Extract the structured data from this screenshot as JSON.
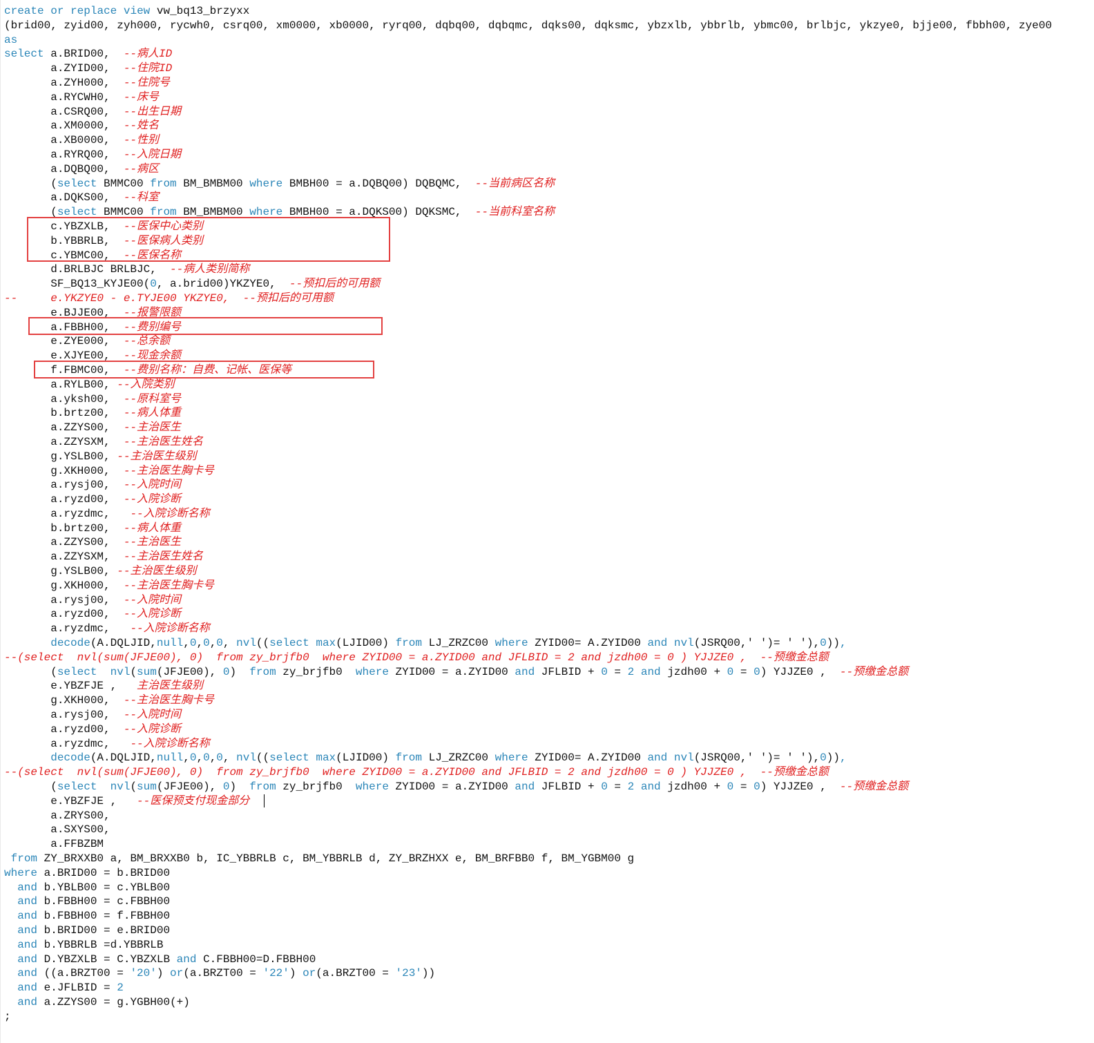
{
  "editor": {
    "colors": {
      "background": "#ffffff",
      "text": "#111111",
      "keyword": "#2b86b8",
      "comment": "#e02020",
      "highlight_box": "#e34040"
    },
    "lines": [
      [
        [
          "k",
          "create"
        ],
        [
          "t",
          " "
        ],
        [
          "k",
          "or"
        ],
        [
          "t",
          " "
        ],
        [
          "k",
          "replace"
        ],
        [
          "t",
          " "
        ],
        [
          "k",
          "view"
        ],
        [
          "t",
          " vw_bq13_brzyxx"
        ]
      ],
      [
        [
          "t",
          "(brid00, zyid00, zyh000, rycwh0, csrq00, xm0000, xb0000, ryrq00, dqbq00, dqbqmc, dqks00, dqksmc, ybzxlb, ybbrlb, ybmc00, brlbjc, ykzye0, bjje00, fbbh00, zye00"
        ]
      ],
      [
        [
          "k",
          "as"
        ]
      ],
      [
        [
          "k",
          "select"
        ],
        [
          "t",
          " a.BRID00,  "
        ],
        [
          "c",
          "--病人ID"
        ]
      ],
      [
        [
          "t",
          "       a.ZYID00,  "
        ],
        [
          "c",
          "--住院ID"
        ]
      ],
      [
        [
          "t",
          "       a.ZYH000,  "
        ],
        [
          "c",
          "--住院号"
        ]
      ],
      [
        [
          "t",
          "       a.RYCWH0,  "
        ],
        [
          "c",
          "--床号"
        ]
      ],
      [
        [
          "t",
          "       a.CSRQ00,  "
        ],
        [
          "c",
          "--出生日期"
        ]
      ],
      [
        [
          "t",
          "       a.XM0000,  "
        ],
        [
          "c",
          "--姓名"
        ]
      ],
      [
        [
          "t",
          "       a.XB0000,  "
        ],
        [
          "c",
          "--性别"
        ]
      ],
      [
        [
          "t",
          "       a.RYRQ00,  "
        ],
        [
          "c",
          "--入院日期"
        ]
      ],
      [
        [
          "t",
          "       a.DQBQ00,  "
        ],
        [
          "c",
          "--病区"
        ]
      ],
      [
        [
          "t",
          "       ("
        ],
        [
          "k",
          "select"
        ],
        [
          "t",
          " BMMC00 "
        ],
        [
          "k",
          "from"
        ],
        [
          "t",
          " BM_BMBM00 "
        ],
        [
          "k",
          "where"
        ],
        [
          "t",
          " BMBH00 = a.DQBQ00) DQBQMC,  "
        ],
        [
          "c",
          "--当前病区名称"
        ]
      ],
      [
        [
          "t",
          "       a.DQKS00,  "
        ],
        [
          "c",
          "--科室"
        ]
      ],
      [
        [
          "t",
          "       ("
        ],
        [
          "k",
          "select"
        ],
        [
          "t",
          " BMMC00 "
        ],
        [
          "k",
          "from"
        ],
        [
          "t",
          " BM_BMBM00 "
        ],
        [
          "k",
          "where"
        ],
        [
          "t",
          " BMBH00 = a.DQKS00) DQKSMC,  "
        ],
        [
          "c",
          "--当前科室名称"
        ]
      ],
      [
        [
          "t",
          "       c.YBZXLB,  "
        ],
        [
          "c",
          "--医保中心类别"
        ]
      ],
      [
        [
          "t",
          "       b.YBBRLB,  "
        ],
        [
          "c",
          "--医保病人类别"
        ]
      ],
      [
        [
          "t",
          "       c.YBMC00,  "
        ],
        [
          "c",
          "--医保名称"
        ]
      ],
      [
        [
          "t",
          "       d.BRLBJC BRLBJC,  "
        ],
        [
          "c",
          "--病人类别简称"
        ]
      ],
      [
        [
          "t",
          "       SF_BQ13_KYJE00("
        ],
        [
          "n",
          "0"
        ],
        [
          "t",
          ", a.brid00)YKZYE0,  "
        ],
        [
          "c",
          "--预扣后的可用额"
        ]
      ],
      [
        [
          "c",
          "--     e.YKZYE0 - e.TYJE00 YKZYE0,  --预扣后的可用额"
        ]
      ],
      [
        [
          "t",
          "       e.BJJE00,  "
        ],
        [
          "c",
          "--报警限额"
        ]
      ],
      [
        [
          "t",
          "       a.FBBH00,  "
        ],
        [
          "c",
          "--费别编号"
        ]
      ],
      [
        [
          "t",
          "       e.ZYE000,  "
        ],
        [
          "c",
          "--总余额"
        ]
      ],
      [
        [
          "t",
          "       e.XJYE00,  "
        ],
        [
          "c",
          "--现金余额"
        ]
      ],
      [
        [
          "t",
          "       f.FBMC00,  "
        ],
        [
          "c",
          "--费别名称：自费、记帐、医保等"
        ]
      ],
      [
        [
          "t",
          "       a.RYLB00, "
        ],
        [
          "c",
          "--入院类别"
        ]
      ],
      [
        [
          "t",
          "       a.yksh00,  "
        ],
        [
          "c",
          "--原科室号"
        ]
      ],
      [
        [
          "t",
          "       b.brtz00,  "
        ],
        [
          "c",
          "--病人体重"
        ]
      ],
      [
        [
          "t",
          "       a.ZZYS00,  "
        ],
        [
          "c",
          "--主治医生"
        ]
      ],
      [
        [
          "t",
          "       a.ZZYSXM,  "
        ],
        [
          "c",
          "--主治医生姓名"
        ]
      ],
      [
        [
          "t",
          "       g.YSLB00, "
        ],
        [
          "c",
          "--主治医生级别"
        ]
      ],
      [
        [
          "t",
          "       g.XKH000,  "
        ],
        [
          "c",
          "--主治医生胸卡号"
        ]
      ],
      [
        [
          "t",
          "       a.rysj00,  "
        ],
        [
          "c",
          "--入院时间"
        ]
      ],
      [
        [
          "t",
          "       a.ryzd00,  "
        ],
        [
          "c",
          "--入院诊断"
        ]
      ],
      [
        [
          "t",
          "       a.ryzdmc,   "
        ],
        [
          "c",
          "--入院诊断名称"
        ]
      ],
      [
        [
          "t",
          "       b.brtz00,  "
        ],
        [
          "c",
          "--病人体重"
        ]
      ],
      [
        [
          "t",
          "       a.ZZYS00,  "
        ],
        [
          "c",
          "--主治医生"
        ]
      ],
      [
        [
          "t",
          "       a.ZZYSXM,  "
        ],
        [
          "c",
          "--主治医生姓名"
        ]
      ],
      [
        [
          "t",
          "       g.YSLB00, "
        ],
        [
          "c",
          "--主治医生级别"
        ]
      ],
      [
        [
          "t",
          "       g.XKH000,  "
        ],
        [
          "c",
          "--主治医生胸卡号"
        ]
      ],
      [
        [
          "t",
          "       a.rysj00,  "
        ],
        [
          "c",
          "--入院时间"
        ]
      ],
      [
        [
          "t",
          "       a.ryzd00,  "
        ],
        [
          "c",
          "--入院诊断"
        ]
      ],
      [
        [
          "t",
          "       a.ryzdmc,   "
        ],
        [
          "c",
          "--入院诊断名称"
        ]
      ],
      [
        [
          "t",
          "       "
        ],
        [
          "k",
          "decode"
        ],
        [
          "t",
          "(A.DQLJID,"
        ],
        [
          "k",
          "null"
        ],
        [
          "t",
          ","
        ],
        [
          "n",
          "0"
        ],
        [
          "t",
          ","
        ],
        [
          "n",
          "0"
        ],
        [
          "t",
          ","
        ],
        [
          "n",
          "0"
        ],
        [
          "t",
          ", "
        ],
        [
          "k",
          "nvl"
        ],
        [
          "t",
          "(("
        ],
        [
          "k",
          "select"
        ],
        [
          "t",
          " "
        ],
        [
          "k",
          "max"
        ],
        [
          "t",
          "(LJID00) "
        ],
        [
          "k",
          "from"
        ],
        [
          "t",
          " LJ_ZRZC00 "
        ],
        [
          "k",
          "where"
        ],
        [
          "t",
          " ZYID00= A.ZYID00 "
        ],
        [
          "k",
          "and"
        ],
        [
          "t",
          " "
        ],
        [
          "k",
          "nvl"
        ],
        [
          "t",
          "(JSRQ00,' ')= ' '),"
        ],
        [
          "n",
          "0"
        ],
        [
          "t",
          "))"
        ],
        [
          "k",
          ","
        ]
      ],
      [
        [
          "c",
          "--(select  nvl(sum(JFJE00), 0)  from zy_brjfb0  where ZYID00 = a.ZYID00 and JFLBID = 2 and jzdh00 = 0 ) YJJZE0 ,  --预缴金总额"
        ]
      ],
      [
        [
          "t",
          "       ("
        ],
        [
          "k",
          "select"
        ],
        [
          "t",
          "  "
        ],
        [
          "k",
          "nvl"
        ],
        [
          "t",
          "("
        ],
        [
          "k",
          "sum"
        ],
        [
          "t",
          "(JFJE00), "
        ],
        [
          "n",
          "0"
        ],
        [
          "t",
          ")  "
        ],
        [
          "k",
          "from"
        ],
        [
          "t",
          " zy_brjfb0  "
        ],
        [
          "k",
          "where"
        ],
        [
          "t",
          " ZYID00 = a.ZYID00 "
        ],
        [
          "k",
          "and"
        ],
        [
          "t",
          " JFLBID + "
        ],
        [
          "n",
          "0"
        ],
        [
          "t",
          " = "
        ],
        [
          "n",
          "2"
        ],
        [
          "t",
          " "
        ],
        [
          "k",
          "and"
        ],
        [
          "t",
          " jzdh00 + "
        ],
        [
          "n",
          "0"
        ],
        [
          "t",
          " = "
        ],
        [
          "n",
          "0"
        ],
        [
          "t",
          ") YJJZE0 ,  "
        ],
        [
          "c",
          "--预缴金总额"
        ]
      ],
      [
        [
          "t",
          "       e.YBZFJE ,   "
        ],
        [
          "c",
          "主治医生级别"
        ]
      ],
      [
        [
          "t",
          "       g.XKH000,  "
        ],
        [
          "c",
          "--主治医生胸卡号"
        ]
      ],
      [
        [
          "t",
          "       a.rysj00,  "
        ],
        [
          "c",
          "--入院时间"
        ]
      ],
      [
        [
          "t",
          "       a.ryzd00,  "
        ],
        [
          "c",
          "--入院诊断"
        ]
      ],
      [
        [
          "t",
          "       a.ryzdmc,   "
        ],
        [
          "c",
          "--入院诊断名称"
        ]
      ],
      [
        [
          "t",
          "       "
        ],
        [
          "k",
          "decode"
        ],
        [
          "t",
          "(A.DQLJID,"
        ],
        [
          "k",
          "null"
        ],
        [
          "t",
          ","
        ],
        [
          "n",
          "0"
        ],
        [
          "t",
          ","
        ],
        [
          "n",
          "0"
        ],
        [
          "t",
          ","
        ],
        [
          "n",
          "0"
        ],
        [
          "t",
          ", "
        ],
        [
          "k",
          "nvl"
        ],
        [
          "t",
          "(("
        ],
        [
          "k",
          "select"
        ],
        [
          "t",
          " "
        ],
        [
          "k",
          "max"
        ],
        [
          "t",
          "(LJID00) "
        ],
        [
          "k",
          "from"
        ],
        [
          "t",
          " LJ_ZRZC00 "
        ],
        [
          "k",
          "where"
        ],
        [
          "t",
          " ZYID00= A.ZYID00 "
        ],
        [
          "k",
          "and"
        ],
        [
          "t",
          " "
        ],
        [
          "k",
          "nvl"
        ],
        [
          "t",
          "(JSRQ00,' ')= ' '),"
        ],
        [
          "n",
          "0"
        ],
        [
          "t",
          "))"
        ],
        [
          "k",
          ","
        ]
      ],
      [
        [
          "c",
          "--(select  nvl(sum(JFJE00), 0)  from zy_brjfb0  where ZYID00 = a.ZYID00 and JFLBID = 2 and jzdh00 = 0 ) YJJZE0 ,  --预缴金总额"
        ]
      ],
      [
        [
          "t",
          "       ("
        ],
        [
          "k",
          "select"
        ],
        [
          "t",
          "  "
        ],
        [
          "k",
          "nvl"
        ],
        [
          "t",
          "("
        ],
        [
          "k",
          "sum"
        ],
        [
          "t",
          "(JFJE00), "
        ],
        [
          "n",
          "0"
        ],
        [
          "t",
          ")  "
        ],
        [
          "k",
          "from"
        ],
        [
          "t",
          " zy_brjfb0  "
        ],
        [
          "k",
          "where"
        ],
        [
          "t",
          " ZYID00 = a.ZYID00 "
        ],
        [
          "k",
          "and"
        ],
        [
          "t",
          " JFLBID + "
        ],
        [
          "n",
          "0"
        ],
        [
          "t",
          " = "
        ],
        [
          "n",
          "2"
        ],
        [
          "t",
          " "
        ],
        [
          "k",
          "and"
        ],
        [
          "t",
          " jzdh00 + "
        ],
        [
          "n",
          "0"
        ],
        [
          "t",
          " = "
        ],
        [
          "n",
          "0"
        ],
        [
          "t",
          ") YJJZE0 ,  "
        ],
        [
          "c",
          "--预缴金总额"
        ]
      ],
      [
        [
          "t",
          "       e.YBZFJE ,   "
        ],
        [
          "c",
          "--医保预支付现金部分"
        ]
      ],
      [
        [
          "t",
          "       a.ZRYS00,"
        ]
      ],
      [
        [
          "t",
          "       a.SXYS00,"
        ]
      ],
      [
        [
          "t",
          "       a.FFBZBM"
        ]
      ],
      [
        [
          "t",
          " "
        ],
        [
          "k",
          "from"
        ],
        [
          "t",
          " ZY_BRXXB0 a, BM_BRXXB0 b, IC_YBBRLB c, BM_YBBRLB d, ZY_BRZHXX e, BM_BRFBB0 f, BM_YGBM00 g"
        ]
      ],
      [
        [
          "k",
          "where"
        ],
        [
          "t",
          " a.BRID00 = b.BRID00"
        ]
      ],
      [
        [
          "t",
          "  "
        ],
        [
          "k",
          "and"
        ],
        [
          "t",
          " b.YBLB00 = c.YBLB00"
        ]
      ],
      [
        [
          "t",
          "  "
        ],
        [
          "k",
          "and"
        ],
        [
          "t",
          " b.FBBH00 = c.FBBH00"
        ]
      ],
      [
        [
          "t",
          "  "
        ],
        [
          "k",
          "and"
        ],
        [
          "t",
          " b.FBBH00 = f.FBBH00"
        ]
      ],
      [
        [
          "t",
          "  "
        ],
        [
          "k",
          "and"
        ],
        [
          "t",
          " b.BRID00 = e.BRID00"
        ]
      ],
      [
        [
          "t",
          "  "
        ],
        [
          "k",
          "and"
        ],
        [
          "t",
          " b.YBBRLB =d.YBBRLB"
        ]
      ],
      [
        [
          "t",
          "  "
        ],
        [
          "k",
          "and"
        ],
        [
          "t",
          " D.YBZXLB = C.YBZXLB "
        ],
        [
          "k",
          "and"
        ],
        [
          "t",
          " C.FBBH00=D.FBBH00"
        ]
      ],
      [
        [
          "t",
          "  "
        ],
        [
          "k",
          "and"
        ],
        [
          "t",
          " ((a.BRZT00 = "
        ],
        [
          "n",
          "'20'"
        ],
        [
          "t",
          ") "
        ],
        [
          "k",
          "or"
        ],
        [
          "t",
          "(a.BRZT00 = "
        ],
        [
          "n",
          "'22'"
        ],
        [
          "t",
          ") "
        ],
        [
          "k",
          "or"
        ],
        [
          "t",
          "(a.BRZT00 = "
        ],
        [
          "n",
          "'23'"
        ],
        [
          "t",
          "))"
        ]
      ],
      [
        [
          "t",
          "  "
        ],
        [
          "k",
          "and"
        ],
        [
          "t",
          " e.JFLBID = "
        ],
        [
          "n",
          "2"
        ]
      ],
      [
        [
          "t",
          "  "
        ],
        [
          "k",
          "and"
        ],
        [
          "t",
          " a.ZZYS00 = g.YGBH00(+)"
        ]
      ],
      [
        [
          "t",
          ";"
        ]
      ]
    ]
  }
}
